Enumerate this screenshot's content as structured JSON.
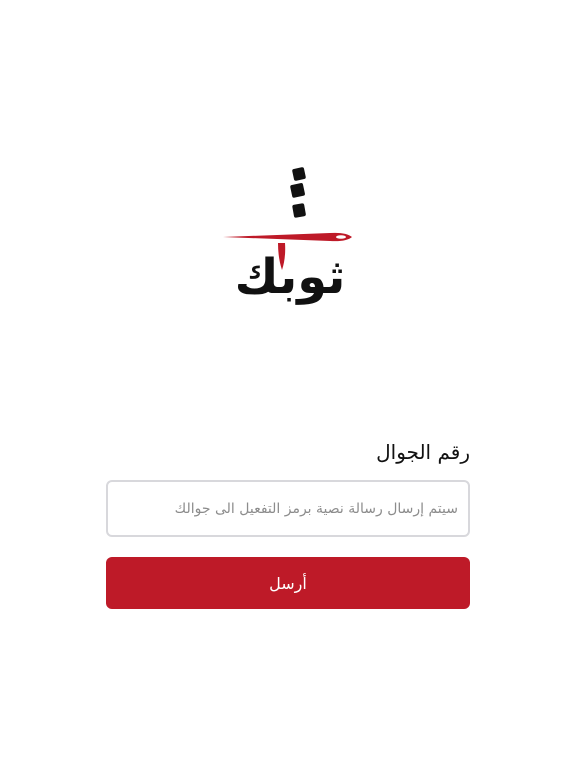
{
  "logo": {
    "text": "ثوبك",
    "icon": "needle-and-thread-logo"
  },
  "form": {
    "phone_label": "رقم الجوال",
    "phone_placeholder": "سيتم إرسال رسالة نصية برمز التفعيل الى جوالك",
    "phone_value": "",
    "send_label": "أرسل"
  },
  "colors": {
    "brand": "#be1a28",
    "background": "#ffffff",
    "text": "#111111",
    "input_border": "#d8d8dc",
    "placeholder": "#8c8c8c"
  }
}
